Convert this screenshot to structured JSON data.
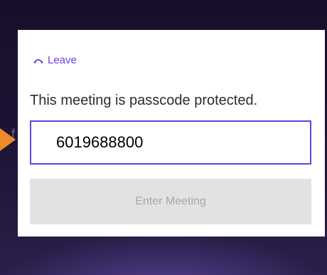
{
  "colors": {
    "accent": "#6a3fe0",
    "arrow": "#ee8a2c",
    "button_bg": "#e2e2e2",
    "button_text": "#a8a8a8"
  },
  "dialog": {
    "leave_label": "Leave",
    "leave_icon": "hang-up-icon",
    "prompt": "This meeting is passcode protected.",
    "passcode_value": "6019688800",
    "enter_label": "Enter Meeting"
  },
  "background": {
    "partial_text": "f"
  }
}
